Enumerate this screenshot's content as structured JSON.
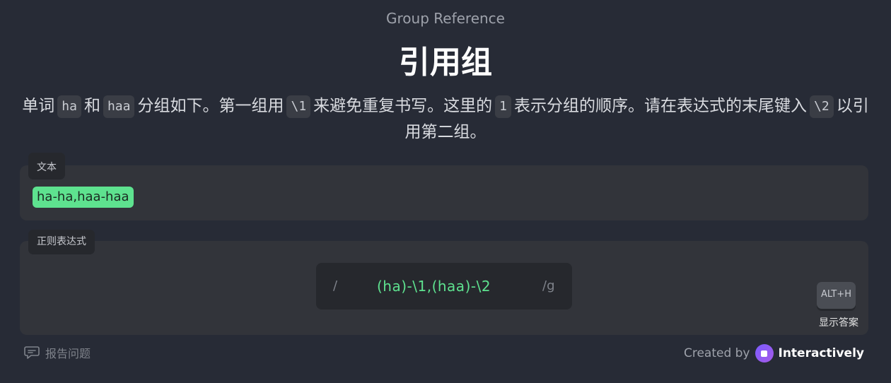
{
  "header": {
    "subtitle": "Group Reference",
    "title": "引用组"
  },
  "description": {
    "t1": "单词",
    "c1": "ha",
    "t2": "和",
    "c2": "haa",
    "t3": "分组如下。第一组用",
    "c3": "\\1",
    "t4": "来避免重复书写。这里的",
    "c4": "1",
    "t5": "表示分组的顺序。请在表达式的末尾键入",
    "c5": "\\2",
    "t6": "以引用第二组。"
  },
  "text_panel": {
    "label": "文本",
    "match": "ha-ha,haa-haa"
  },
  "regex_panel": {
    "label": "正则表达式",
    "open_slash": "/",
    "pattern": "(ha)-\\1,(haa)-\\2",
    "flags": "/g",
    "shortcut": "ALT+H",
    "show_answer": "显示答案"
  },
  "footer": {
    "report": "报告问题",
    "created_by": "Created by",
    "brand": "Interactively"
  },
  "colors": {
    "background": "#272b36",
    "match_highlight": "#5ee28f",
    "brand_accent": "#7b5cff"
  }
}
